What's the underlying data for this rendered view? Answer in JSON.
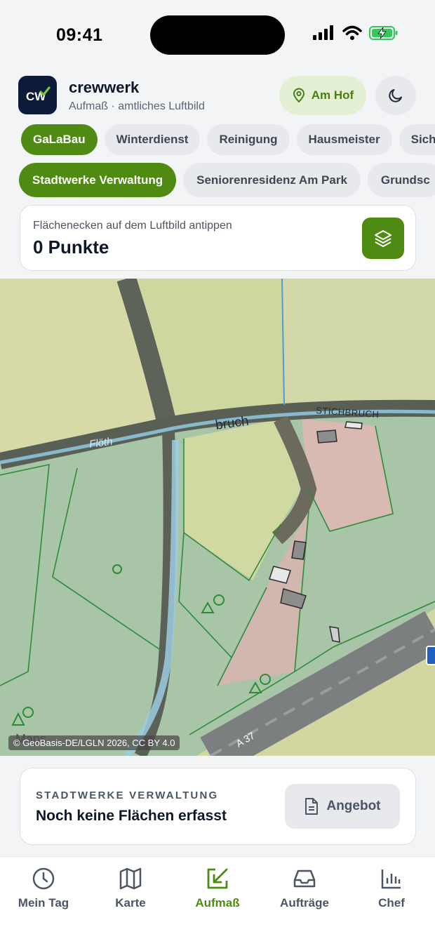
{
  "status_bar": {
    "time": "09:41"
  },
  "header": {
    "app_name": "crewwerk",
    "subtitle": "Aufmaß · amtliches Luftbild",
    "location_button": "Am Hof",
    "logo_text": "CW"
  },
  "categories": [
    "GaLaBau",
    "Winterdienst",
    "Reinigung",
    "Hausmeister",
    "Siche"
  ],
  "customers": [
    "Stadtwerke Verwaltung",
    "Seniorenresidenz Am Park",
    "Grundsc"
  ],
  "measure": {
    "hint": "Flächenecken auf dem Luftbild antippen",
    "count": "0 Punkte"
  },
  "map": {
    "attribution": "© GeoBasis-DE/LGLN 2026, CC BY 4.0",
    "labels": [
      "Flöth",
      "bruch",
      "STICHBRUCH",
      "A 37",
      "Maps"
    ]
  },
  "summary": {
    "org": "STADTWERKE VERWALTUNG",
    "status": "Noch keine Flächen erfasst",
    "offer_button": "Angebot"
  },
  "tabs": [
    "Mein Tag",
    "Karte",
    "Aufmaß",
    "Aufträge",
    "Chef"
  ],
  "colors": {
    "accent": "#4f8a12",
    "accent_light": "#e3f0d3",
    "navy": "#0d1b3a"
  }
}
